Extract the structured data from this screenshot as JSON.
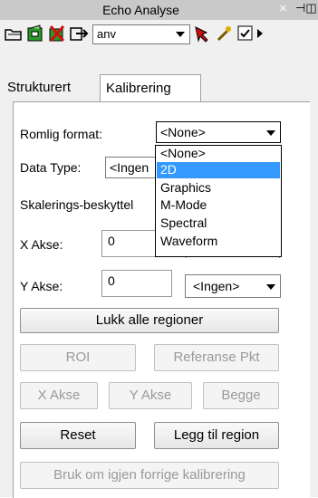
{
  "window": {
    "title": "Echo Analyse",
    "close_glyph": "×",
    "pin_glyph": "⊣⊨"
  },
  "toolbar": {
    "icons": [
      "open-folder-icon",
      "green-save-icon",
      "red-delete-icon",
      "export-icon"
    ],
    "combo_value": "anv",
    "right_icons": [
      "red-pointer-icon",
      "wand-icon",
      "checkbox-icon"
    ]
  },
  "tabs": [
    {
      "label": "Strukturert",
      "active": false
    },
    {
      "label": "Kalibrering",
      "active": true
    }
  ],
  "form": {
    "romlig_format_label": "Romlig format:",
    "romlig_format_value": "<None>",
    "data_type_label": "Data Type:",
    "data_type_value": "<Ingen",
    "skalering_label": "Skalerings-beskyttel",
    "x_akse_label": "X Akse:",
    "x_akse_value": "0",
    "y_akse_label": "Y Akse:",
    "y_akse_value": "0",
    "y_unit_value": "<Ingen>"
  },
  "dropdown_options": [
    {
      "label": "<None>",
      "selected": false
    },
    {
      "label": "2D",
      "selected": true
    },
    {
      "label": "Graphics",
      "selected": false
    },
    {
      "label": "M-Mode",
      "selected": false
    },
    {
      "label": "Spectral",
      "selected": false
    },
    {
      "label": "Waveform",
      "selected": false
    }
  ],
  "buttons": {
    "lukk_alle": "Lukk alle regioner",
    "roi": "ROI",
    "referanse": "Referanse Pkt",
    "x_akse": "X Akse",
    "y_akse": "Y Akse",
    "begge": "Begge",
    "reset": "Reset",
    "legg_til": "Legg til region",
    "bruk_om_igjen": "Bruk om igjen forrige kalibrering"
  },
  "colors": {
    "selection": "#3399ff",
    "disabled_text": "#9a9a9a"
  }
}
